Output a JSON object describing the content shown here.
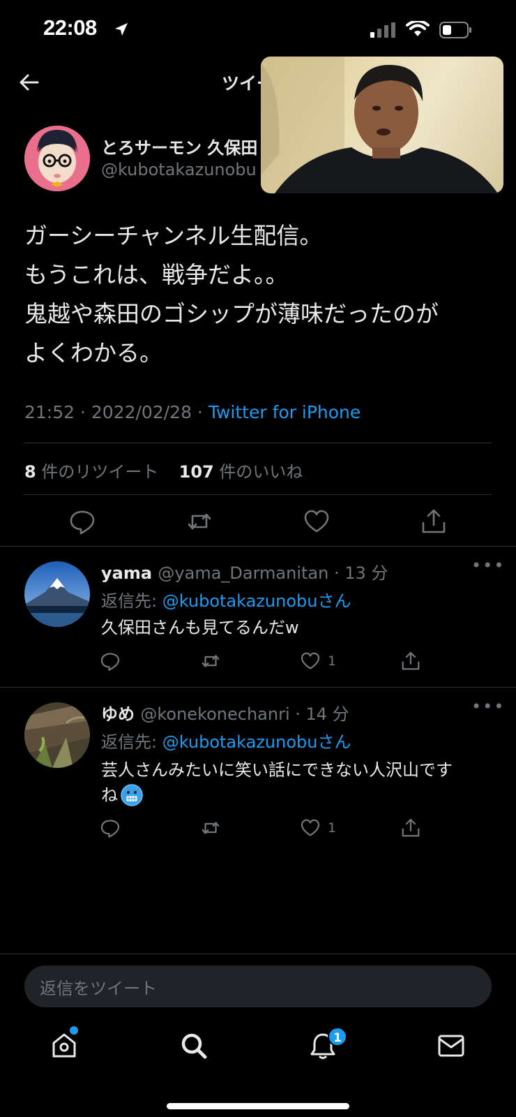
{
  "status_bar": {
    "time": "22:08"
  },
  "nav": {
    "title": "ツイート"
  },
  "tweet": {
    "author_name": "とろサーモン 久保田",
    "author_handle": "@kubotakazunobu",
    "text": "ガーシーチャンネル生配信。\nもうこれは、戦争だよ。。\n鬼越や森田のゴシップが薄味だったのが\nよくわかる。",
    "time": "21:52 · 2022/02/28 · ",
    "source": "Twitter for iPhone",
    "retweet_count": "8",
    "retweet_label": " 件のリツイート",
    "like_count": "107",
    "like_label": " 件のいいね"
  },
  "replies": [
    {
      "name": "yama",
      "handle": "@yama_Darmanitan",
      "time": " · 13 分",
      "reply_to_label": "返信先: ",
      "reply_to": "@kubotakazunobuさん",
      "text": "久保田さんも見てるんだw",
      "like_count": "1"
    },
    {
      "name": "ゆめ",
      "handle": "@konekonechanri",
      "time": " · 14 分",
      "reply_to_label": "返信先: ",
      "reply_to": "@kubotakazunobuさん",
      "text": "芸人さんみたいに笑い話にできない人沢山です\nね",
      "like_count": "1"
    }
  ],
  "compose": {
    "placeholder": "返信をツイート"
  },
  "tab_bar": {
    "notifications_badge": "1"
  },
  "icons": [
    "location-arrow-icon",
    "signal-icon",
    "wifi-icon",
    "battery-icon",
    "back-arrow-icon",
    "reply-icon",
    "retweet-icon",
    "like-icon",
    "share-icon",
    "more-icon",
    "home-icon",
    "search-icon",
    "bell-icon",
    "mail-icon",
    "freezing-face-emoji"
  ],
  "colors": {
    "accent": "#1d9bf0",
    "background": "#000000",
    "muted": "#71767b",
    "divider": "#2f3336"
  }
}
